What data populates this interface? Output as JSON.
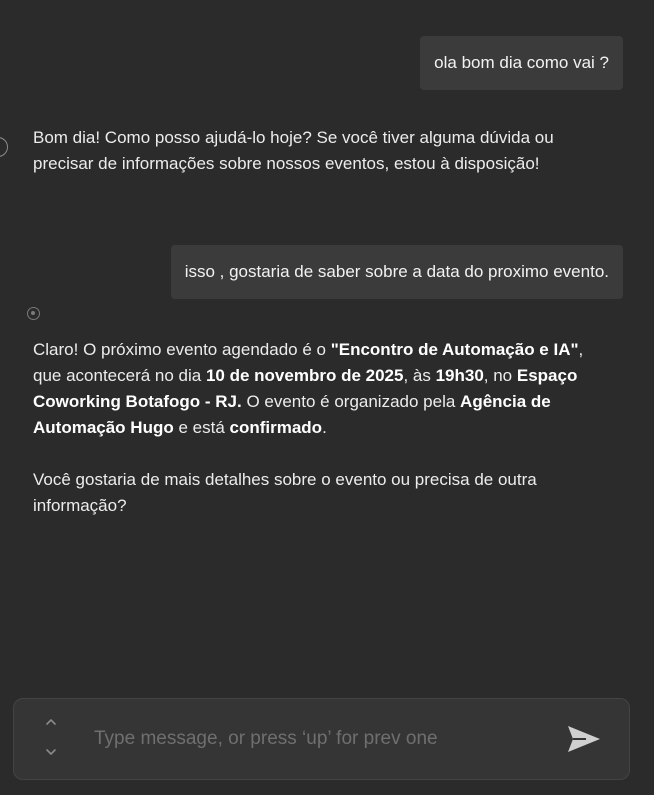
{
  "messages": [
    {
      "role": "user",
      "text": "ola bom dia como vai ?"
    },
    {
      "role": "assistant",
      "text": "Bom dia! Como posso ajudá-lo hoje? Se você tiver alguma dúvida ou precisar de informações sobre nossos eventos, estou à disposição!"
    },
    {
      "role": "user",
      "text": "isso , gostaria de saber sobre a data do proximo evento."
    },
    {
      "role": "assistant",
      "segments": [
        "Claro! O próximo evento agendado é o ",
        "\"Encontro de Automação e IA\"",
        ", que acontecerá no dia ",
        "10 de novembro de 2025",
        ", às ",
        "19h30",
        ", no ",
        "Espaço Coworking Botafogo - RJ.",
        " O evento é organizado pela ",
        "Agência de Automação Hugo",
        " e está ",
        "confirmado",
        "."
      ],
      "followup": "Você gostaria de mais detalhes sobre o evento ou precisa de outra informação?"
    }
  ],
  "composer": {
    "placeholder": "Type message, or press ‘up’ for prev one",
    "value": ""
  },
  "icons": {
    "history_up": "chevron-up-icon",
    "history_down": "chevron-down-icon",
    "send": "send-icon",
    "assistant_avatar": "assistant-avatar-icon"
  },
  "colors": {
    "background": "#2b2b2b",
    "user_bubble": "#3b3b3b",
    "composer_background": "#353535",
    "text": "#ececec",
    "placeholder": "#6f6f6f",
    "send_icon": "#d0d0d0"
  }
}
